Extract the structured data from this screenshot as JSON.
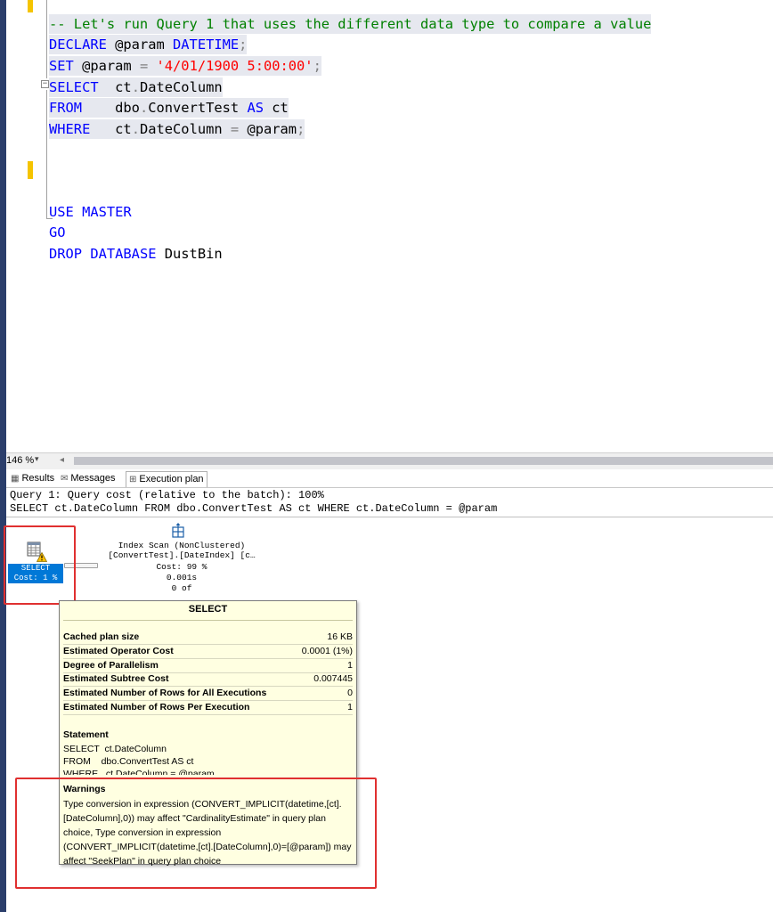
{
  "editor": {
    "lines": [
      {
        "tokens": [
          {
            "t": "-- Let's run Query 1 that uses the different data type to compare a value",
            "c": "cm"
          }
        ]
      },
      {
        "tokens": [
          {
            "t": "DECLARE ",
            "c": "kw"
          },
          {
            "t": "@param ",
            "c": "pl"
          },
          {
            "t": "DATETIME",
            "c": "kw"
          },
          {
            "t": ";",
            "c": "gy"
          }
        ]
      },
      {
        "tokens": [
          {
            "t": "SET ",
            "c": "kw"
          },
          {
            "t": "@param ",
            "c": "pl"
          },
          {
            "t": "= ",
            "c": "gy"
          },
          {
            "t": "'4/01/1900 5:00:00'",
            "c": "st"
          },
          {
            "t": ";",
            "c": "gy"
          }
        ]
      },
      {
        "tokens": [
          {
            "t": "SELECT  ",
            "c": "kw"
          },
          {
            "t": "ct",
            "c": "pl"
          },
          {
            "t": ".",
            "c": "gy"
          },
          {
            "t": "DateColumn",
            "c": "pl"
          }
        ]
      },
      {
        "tokens": [
          {
            "t": "FROM    ",
            "c": "kw"
          },
          {
            "t": "dbo",
            "c": "pl"
          },
          {
            "t": ".",
            "c": "gy"
          },
          {
            "t": "ConvertTest ",
            "c": "pl"
          },
          {
            "t": "AS ",
            "c": "kw"
          },
          {
            "t": "ct",
            "c": "pl"
          }
        ]
      },
      {
        "tokens": [
          {
            "t": "WHERE   ",
            "c": "kw"
          },
          {
            "t": "ct",
            "c": "pl"
          },
          {
            "t": ".",
            "c": "gy"
          },
          {
            "t": "DateColumn ",
            "c": "pl"
          },
          {
            "t": "= ",
            "c": "gy"
          },
          {
            "t": "@param",
            "c": "pl"
          },
          {
            "t": ";",
            "c": "gy"
          }
        ]
      },
      {
        "tokens": []
      },
      {
        "tokens": []
      },
      {
        "tokens": []
      },
      {
        "tokens": []
      },
      {
        "tokens": [
          {
            "t": "USE ",
            "c": "kw"
          },
          {
            "t": "MASTER",
            "c": "kw"
          }
        ]
      },
      {
        "tokens": [
          {
            "t": "GO",
            "c": "kw"
          }
        ]
      },
      {
        "tokens": [
          {
            "t": "DROP ",
            "c": "kw"
          },
          {
            "t": "DATABASE ",
            "c": "kw"
          },
          {
            "t": "DustBin",
            "c": "pl"
          }
        ]
      }
    ],
    "fold_glyph": "−"
  },
  "zoom": {
    "value": "146 %",
    "dropdown": "▾",
    "scroll_left": "◂"
  },
  "tabs": [
    {
      "icon": "▦",
      "label": "Results"
    },
    {
      "icon": "✉",
      "label": "Messages"
    },
    {
      "icon": "⊞",
      "label": "Execution plan"
    }
  ],
  "plan": {
    "query_header": "Query 1: Query cost (relative to the batch): 100%",
    "query_sql": "SELECT ct.DateColumn FROM dbo.ConvertTest AS ct WHERE ct.DateColumn = @param",
    "select_node": {
      "label": "SELECT",
      "cost": "Cost: 1 %"
    },
    "index_scan": {
      "lines": [
        "Index Scan (NonClustered)",
        "[ConvertTest].[DateIndex] [c…",
        "Cost: 99 %",
        "0.001s",
        "0 of"
      ]
    },
    "tooltip": {
      "title": "SELECT",
      "rows": [
        {
          "label": "Cached plan size",
          "value": "16 KB"
        },
        {
          "label": "Estimated Operator Cost",
          "value": "0.0001 (1%)"
        },
        {
          "label": "Degree of Parallelism",
          "value": "1"
        },
        {
          "label": "Estimated Subtree Cost",
          "value": "0.007445"
        },
        {
          "label": "Estimated Number of Rows for All Executions",
          "value": "0"
        },
        {
          "label": "Estimated Number of Rows Per Execution",
          "value": "1"
        }
      ],
      "statement_label": "Statement",
      "statement_lines": [
        "SELECT  ct.DateColumn",
        "FROM    dbo.ConvertTest AS ct",
        "WHERE   ct.DateColumn = @param"
      ],
      "warnings_label": "Warnings",
      "warnings_text": "Type conversion in expression (CONVERT_IMPLICIT(datetime,[ct].[DateColumn],0)) may affect \"CardinalityEstimate\" in query plan choice, Type conversion in expression (CONVERT_IMPLICIT(datetime,[ct].[DateColumn],0)=[@param]) may affect \"SeekPlan\" in query plan choice"
    }
  }
}
